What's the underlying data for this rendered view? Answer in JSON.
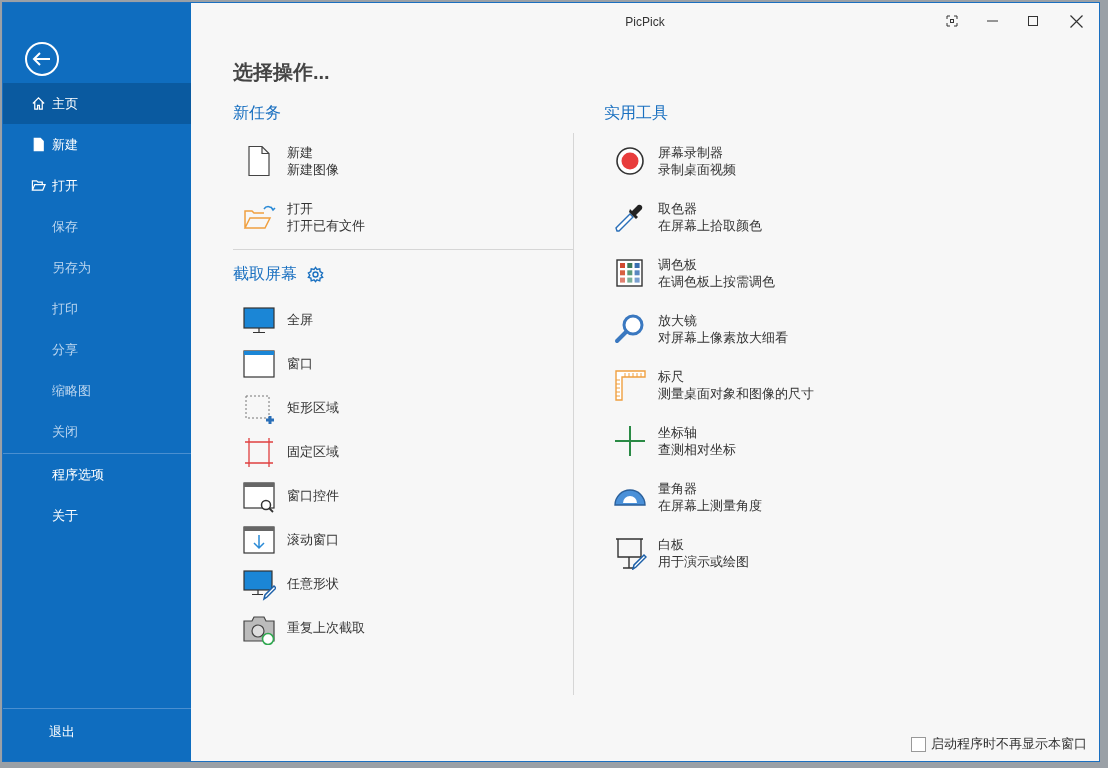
{
  "window": {
    "title": "PicPick"
  },
  "sidebar": {
    "items": [
      {
        "label": "主页",
        "selected": true,
        "disabled": false
      },
      {
        "label": "新建",
        "selected": false,
        "disabled": false
      },
      {
        "label": "打开",
        "selected": false,
        "disabled": false
      },
      {
        "label": "保存",
        "selected": false,
        "disabled": true
      },
      {
        "label": "另存为",
        "selected": false,
        "disabled": true
      },
      {
        "label": "打印",
        "selected": false,
        "disabled": true
      },
      {
        "label": "分享",
        "selected": false,
        "disabled": true
      },
      {
        "label": "缩略图",
        "selected": false,
        "disabled": true
      },
      {
        "label": "关闭",
        "selected": false,
        "disabled": true
      }
    ],
    "app_items": [
      {
        "label": "程序选项",
        "selected": false,
        "disabled": false
      },
      {
        "label": "关于",
        "selected": false,
        "disabled": false
      }
    ],
    "exit": "退出"
  },
  "heading": "选择操作...",
  "new_task": {
    "title": "新任务",
    "items": [
      {
        "kind": "newfile",
        "name": "新建",
        "desc": "新建图像"
      },
      {
        "kind": "openfile",
        "name": "打开",
        "desc": "打开已有文件"
      }
    ]
  },
  "capture": {
    "title": "截取屏幕",
    "items": [
      {
        "kind": "fullscreen",
        "name": "全屏"
      },
      {
        "kind": "window",
        "name": "窗口"
      },
      {
        "kind": "region",
        "name": "矩形区域"
      },
      {
        "kind": "fixed",
        "name": "固定区域"
      },
      {
        "kind": "control",
        "name": "窗口控件"
      },
      {
        "kind": "scroll",
        "name": "滚动窗口"
      },
      {
        "kind": "freehand",
        "name": "任意形状"
      },
      {
        "kind": "repeat",
        "name": "重复上次截取"
      }
    ]
  },
  "tools": {
    "title": "实用工具",
    "items": [
      {
        "kind": "recorder",
        "name": "屏幕录制器",
        "desc": "录制桌面视频"
      },
      {
        "kind": "picker",
        "name": "取色器",
        "desc": "在屏幕上拾取颜色"
      },
      {
        "kind": "palette",
        "name": "调色板",
        "desc": "在调色板上按需调色"
      },
      {
        "kind": "magnifier",
        "name": "放大镜",
        "desc": "对屏幕上像素放大细看"
      },
      {
        "kind": "ruler",
        "name": "标尺",
        "desc": "测量桌面对象和图像的尺寸"
      },
      {
        "kind": "crosshair",
        "name": "坐标轴",
        "desc": "查测相对坐标"
      },
      {
        "kind": "protractor",
        "name": "量角器",
        "desc": "在屏幕上测量角度"
      },
      {
        "kind": "whiteboard",
        "name": "白板",
        "desc": "用于演示或绘图"
      }
    ]
  },
  "footer": {
    "label": "启动程序时不再显示本窗口",
    "checked": false
  }
}
